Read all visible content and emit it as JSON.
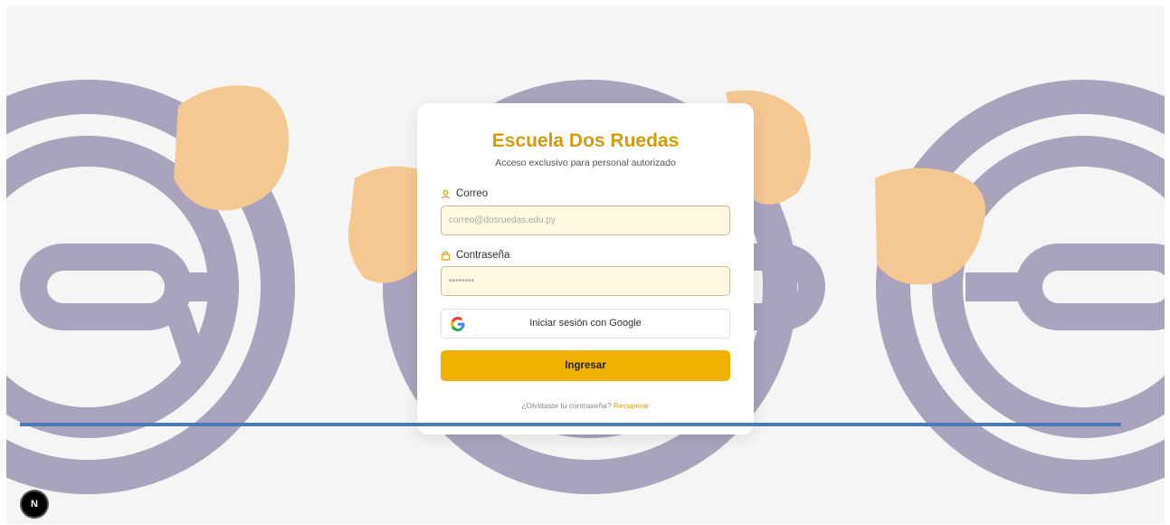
{
  "app": {
    "title": "Escuela Dos Ruedas",
    "subtitle": "Acceso exclusivo para personal autorizado"
  },
  "form": {
    "email_label": "Correo",
    "email_placeholder": "correo@dosruedas.edu.py",
    "email_value": "",
    "password_label": "Contraseña",
    "password_placeholder": "••••••••",
    "password_value": ""
  },
  "buttons": {
    "google_label": "Iniciar sesión con Google",
    "submit_label": "Ingresar"
  },
  "footer": {
    "forgot_text": "¿Olvidaste tu contraseña?",
    "recover_link": "Recuperar"
  },
  "badge": {
    "letter": "N"
  },
  "icons": {
    "email": "user-icon",
    "password": "lock-icon",
    "google": "google-logo-icon",
    "badge": "nextjs-logo-icon"
  },
  "colors": {
    "accent": "#d49a0a",
    "button": "#f0b200",
    "input_bg": "#fff9e2",
    "wheel": "#a9a3bd",
    "hand": "#f5c891",
    "divider": "#4a7ab8",
    "background": "#f5f5f5"
  }
}
